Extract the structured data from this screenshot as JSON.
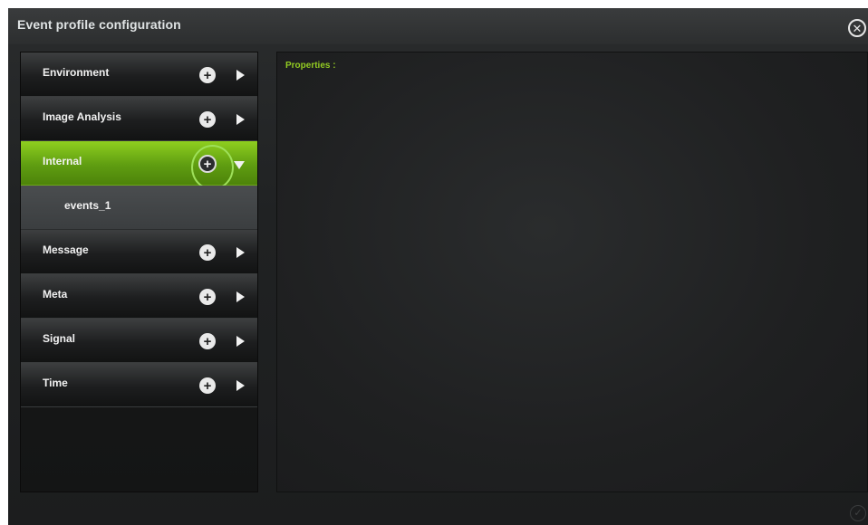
{
  "dialog": {
    "title": "Event profile configuration",
    "close_glyph": "✕"
  },
  "categories": [
    {
      "label": "Environment",
      "active": false
    },
    {
      "label": "Image Analysis",
      "active": false
    },
    {
      "label": "Internal",
      "active": true,
      "children": [
        {
          "label": "events_1"
        }
      ]
    },
    {
      "label": "Message",
      "active": false
    },
    {
      "label": "Meta",
      "active": false
    },
    {
      "label": "Signal",
      "active": false
    },
    {
      "label": "Time",
      "active": false
    }
  ],
  "glyphs": {
    "plus": "+",
    "confirm": "✓"
  },
  "properties": {
    "label": "Properties :"
  },
  "colors": {
    "accent": "#7fbf1a",
    "highlight_ring": "#9ee05a",
    "properties_label": "#93cc22"
  },
  "icons": {
    "close": "close-icon",
    "add": "plus-icon",
    "expand": "triangle-right-icon",
    "expanded": "triangle-down-icon",
    "confirm": "checkmark-icon"
  }
}
